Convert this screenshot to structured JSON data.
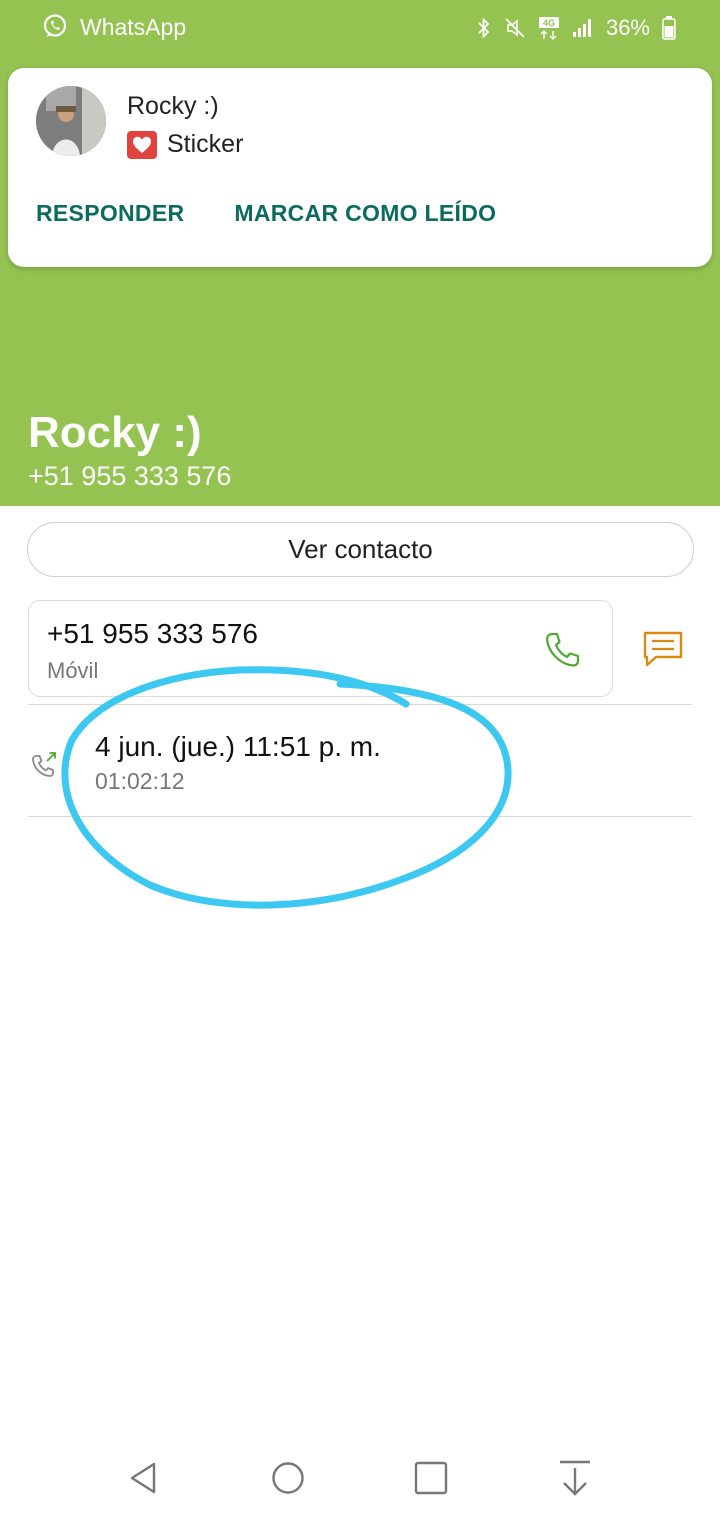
{
  "status_bar": {
    "app_name": "WhatsApp",
    "battery": "36%",
    "icons": [
      "whatsapp-icon",
      "bluetooth-icon",
      "mute-icon",
      "4g-icon",
      "signal-icon",
      "battery-icon"
    ]
  },
  "notification": {
    "title": "Rocky :)",
    "message": "Sticker",
    "message_icon": "heart-icon",
    "actions": {
      "reply": "RESPONDER",
      "mark_read": "MARCAR COMO LEÍDO"
    }
  },
  "contact": {
    "name": "Rocky :)",
    "phone": "+51 955 333 576",
    "view_contact": "Ver contacto"
  },
  "phone_entry": {
    "number": "+51 955 333 576",
    "type": "Móvil",
    "icons": [
      "call-icon",
      "message-icon"
    ]
  },
  "call_log": [
    {
      "date": "4 jun. (jue.) 11:51 p. m.",
      "duration": "01:02:12",
      "icon": "outgoing-call-icon"
    }
  ],
  "nav_bar": {
    "icons": [
      "back-icon",
      "home-icon",
      "recents-icon",
      "notifications-down-icon"
    ]
  },
  "colors": {
    "header_green": "#94c351",
    "action_teal": "#0c6b5f",
    "call_green": "#4fa832",
    "message_orange": "#d88a12",
    "annotation_blue": "#3cc8f0"
  }
}
